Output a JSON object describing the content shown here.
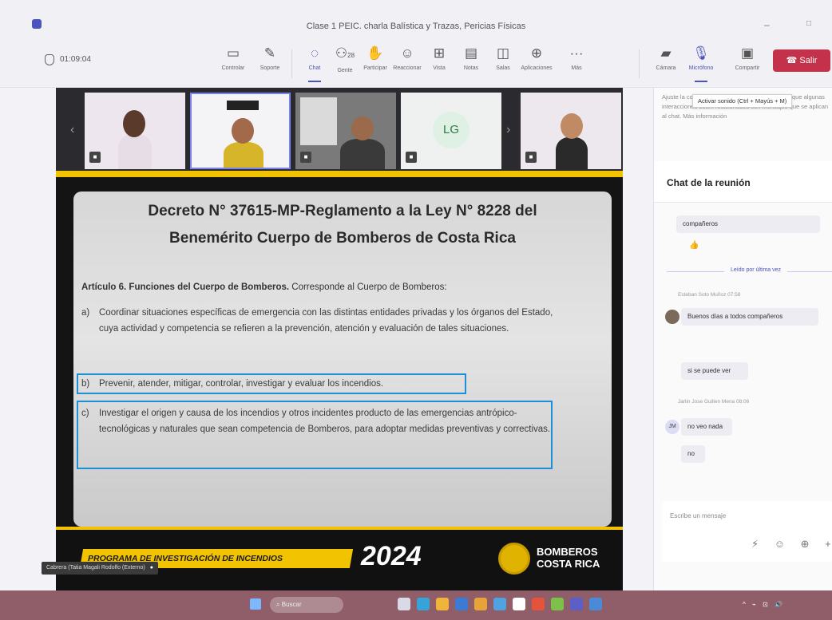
{
  "window": {
    "title": "Clase 1 PEIC. charla Balística y Trazas, Pericias Físicas",
    "minimize": "–",
    "maximize": "□"
  },
  "toolbar": {
    "timer": "01:09:04",
    "controls": [
      {
        "icon": "share-screen-icon",
        "label": "Controlar"
      },
      {
        "icon": "pencil-icon",
        "label": "Soporte"
      },
      {
        "icon": "chat-icon",
        "label": "Chat"
      },
      {
        "icon": "people-icon",
        "label": "Gente",
        "count": "28"
      },
      {
        "icon": "hand-icon",
        "label": "Participar"
      },
      {
        "icon": "smile-icon",
        "label": "Reaccionar"
      },
      {
        "icon": "grid-icon",
        "label": "Vista"
      },
      {
        "icon": "notes-icon",
        "label": "Notas"
      },
      {
        "icon": "rooms-icon",
        "label": "Salas"
      },
      {
        "icon": "apps-icon",
        "label": "Aplicaciones"
      },
      {
        "icon": "more-icon",
        "label": "Más"
      },
      {
        "icon": "camera-icon",
        "label": "Cámara"
      },
      {
        "icon": "mic-icon",
        "label": "Micrófono"
      },
      {
        "icon": "share-icon",
        "label": "Compartir"
      }
    ],
    "leave_label": "Salir"
  },
  "participants": {
    "initials": "LG"
  },
  "slide": {
    "title_line1": "Decreto N° 37615-MP-Reglamento a la Ley N° 8228 del",
    "title_line2": "Benemérito Cuerpo de Bomberos de Costa Rica",
    "article_bold": "Artículo 6. Funciones del Cuerpo de Bomberos.",
    "article_rest": " Corresponde al Cuerpo de Bomberos:",
    "items": [
      {
        "letter": "a)",
        "text": "Coordinar situaciones específicas de emergencia con las distintas entidades privadas y los órganos del Estado, cuya actividad y competencia se refieren a la prevención, atención y evaluación de tales situaciones."
      },
      {
        "letter": "b)",
        "text": "Prevenir, atender, mitigar, controlar, investigar y evaluar los incendios."
      },
      {
        "letter": "c)",
        "text": "Investigar el origen y causa de los incendios y otros incidentes producto de las emergencias antrópico-tecnológicas y naturales que sean competencia de Bomberos, para adoptar medidas preventivas y correctivas."
      }
    ],
    "program": "PROGRAMA DE INVESTIGACIÓN DE INCENDIOS",
    "year": "2024",
    "brand_line1": "BOMBEROS",
    "brand_line2": "COSTA RICA"
  },
  "presenter_tag": "Cabrera (Tatia Magali Rodolfo (Externo)",
  "chat": {
    "notice": "Ajuste la configuración de privacidad. Es posible que algunas interacciones estén relacionados con mensajes que se aplican al chat. Más información",
    "tooltip": "Activar sonido (Ctrl + Mayús + M)",
    "title": "Chat de la reunión",
    "msg_prev": "compañeros",
    "unread": "Leído por última vez",
    "msg1_sender": "Esteban Soto Muñoz 07:58",
    "msg1_text": "Buenos días a todos compañeros",
    "msg2_text": "si se puede ver",
    "msg3_sender": "Jarlin Jose Guillen Mena 08:06",
    "msg3_initials": "JM",
    "msg3_text": "no veo nada",
    "msg4_text": "no",
    "compose_placeholder": "Escribe un mensaje",
    "compose_tools": "⚡ ☺ ⊕ +"
  },
  "taskbar": {
    "search_placeholder": "Buscar",
    "tray": "^ ⌁ ⊡ 🔊"
  },
  "colors": {
    "accent": "#4b53bc",
    "leave": "#c4314b",
    "highlight": "#1e8fd6",
    "brand_yellow": "#f2c300"
  }
}
